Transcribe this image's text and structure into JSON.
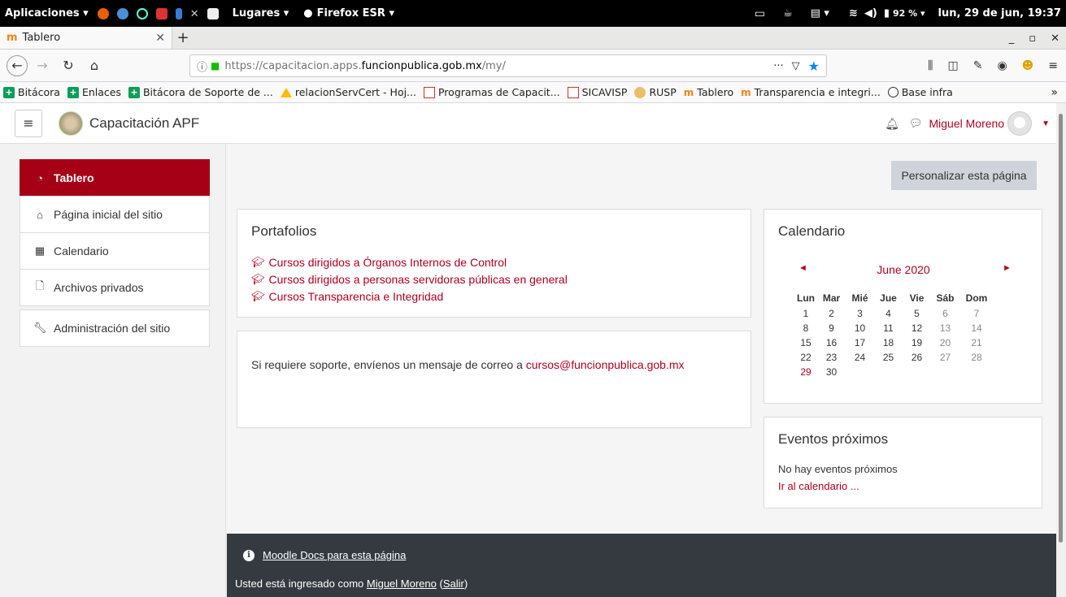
{
  "gnome": {
    "apps_label": "Aplicaciones ▾",
    "places_label": "Lugares ▾",
    "firefox_label": "Firefox ESR ▾",
    "battery": "92 % ▾",
    "clock": "lun, 29 de jun, 19:37"
  },
  "browser": {
    "tab_title": "Tablero",
    "tab_favicon": "m",
    "url_prefix": "https://capacitacion.apps.",
    "url_host": "funcionpublica.gob.mx",
    "url_path": "/my/",
    "url_more": "···"
  },
  "bookmarks": [
    {
      "label": "Bitácora",
      "icon": "green-plus"
    },
    {
      "label": "Enlaces",
      "icon": "green-plus"
    },
    {
      "label": "Bitácora de Soporte de ...",
      "icon": "green-plus"
    },
    {
      "label": "relacionServCert - Hoj...",
      "icon": "drive"
    },
    {
      "label": "Programas de Capacit...",
      "icon": "red-doc"
    },
    {
      "label": "SICAVISP",
      "icon": "red-doc"
    },
    {
      "label": "RUSP",
      "icon": "yellow-dot"
    },
    {
      "label": "Tablero",
      "icon": "moodle"
    },
    {
      "label": "Transparencia e integri...",
      "icon": "moodle"
    },
    {
      "label": "Base infra",
      "icon": "globe"
    }
  ],
  "header": {
    "site_name": "Capacitación APF",
    "user_name": "Miguel Moreno"
  },
  "nav": [
    {
      "label": "Tablero",
      "icon": "dashboard-icon",
      "active": true
    },
    {
      "label": "Página inicial del sitio",
      "icon": "home-icon",
      "active": false
    },
    {
      "label": "Calendario",
      "icon": "calendar-icon",
      "active": false
    },
    {
      "label": "Archivos privados",
      "icon": "file-icon",
      "active": false
    },
    {
      "label": "Administración del sitio",
      "icon": "wrench-icon",
      "active": false
    }
  ],
  "main": {
    "customize_label": "Personalizar esta página",
    "portfolios": {
      "title": "Portafolios",
      "links": [
        "Cursos dirigidos a Órganos Internos de Control",
        "Cursos dirigidos a personas servidoras públicas en general",
        "Cursos Transparencia e Integridad"
      ]
    },
    "support": {
      "text": "Si requiere soporte, envíenos un mensaje de correo a ",
      "email": "cursos@funcionpublica.gob.mx"
    },
    "calendar": {
      "title": "Calendario",
      "month": "June 2020",
      "prev": "◄",
      "next": "►",
      "days": [
        "Lun",
        "Mar",
        "Mié",
        "Jue",
        "Vie",
        "Sáb",
        "Dom"
      ],
      "weeks": [
        [
          "1",
          "2",
          "3",
          "4",
          "5",
          "6",
          "7"
        ],
        [
          "8",
          "9",
          "10",
          "11",
          "12",
          "13",
          "14"
        ],
        [
          "15",
          "16",
          "17",
          "18",
          "19",
          "20",
          "21"
        ],
        [
          "22",
          "23",
          "24",
          "25",
          "26",
          "27",
          "28"
        ],
        [
          "29",
          "30",
          "",
          "",
          "",
          "",
          ""
        ]
      ],
      "today": "29"
    },
    "events": {
      "title": "Eventos próximos",
      "empty": "No hay eventos próximos",
      "link": "Ir al calendario ..."
    }
  },
  "footer": {
    "docs_link": "Moodle Docs para esta página",
    "logged_prefix": "Usted está ingresado como ",
    "logged_user": "Miguel Moreno",
    "logout_open": " (",
    "logout_label": "Salir",
    "logout_close": ")"
  },
  "colors": {
    "brand": "#a50016",
    "link": "#b0001e",
    "footer_bg": "#343a40"
  }
}
